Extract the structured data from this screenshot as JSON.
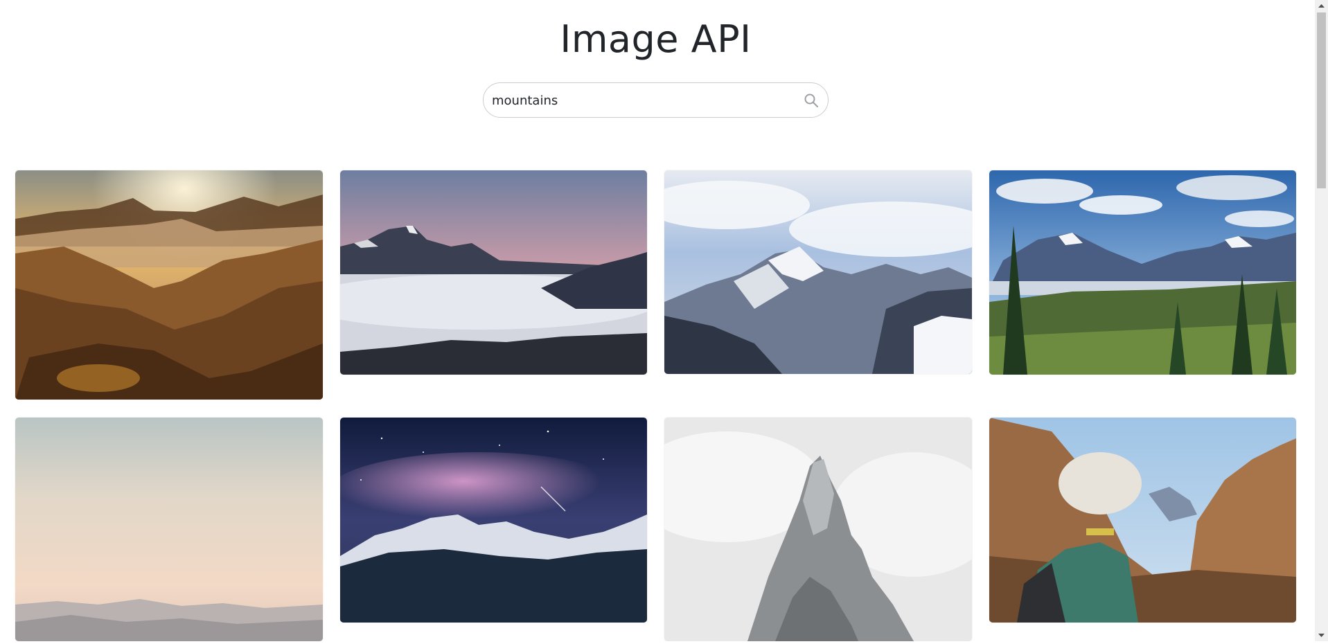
{
  "app": {
    "title": "Image API"
  },
  "search": {
    "value": "mountains",
    "icon": "search-icon"
  },
  "gallery": {
    "images": [
      {
        "scene": "desert-sunset-mountains"
      },
      {
        "scene": "peaks-above-cloud-sea"
      },
      {
        "scene": "snowy-himalaya-peak"
      },
      {
        "scene": "alpine-valley-pines"
      },
      {
        "scene": "hazy-pastel-ridges"
      },
      {
        "scene": "milky-way-snowy-range"
      },
      {
        "scene": "rocky-spire-in-clouds"
      },
      {
        "scene": "hiker-desert-canyon"
      }
    ]
  },
  "colors": {
    "title": "#212529",
    "border": "#c9cdd1",
    "scrollbar_track": "#f1f1f1",
    "scrollbar_thumb": "#c1c1c1"
  }
}
